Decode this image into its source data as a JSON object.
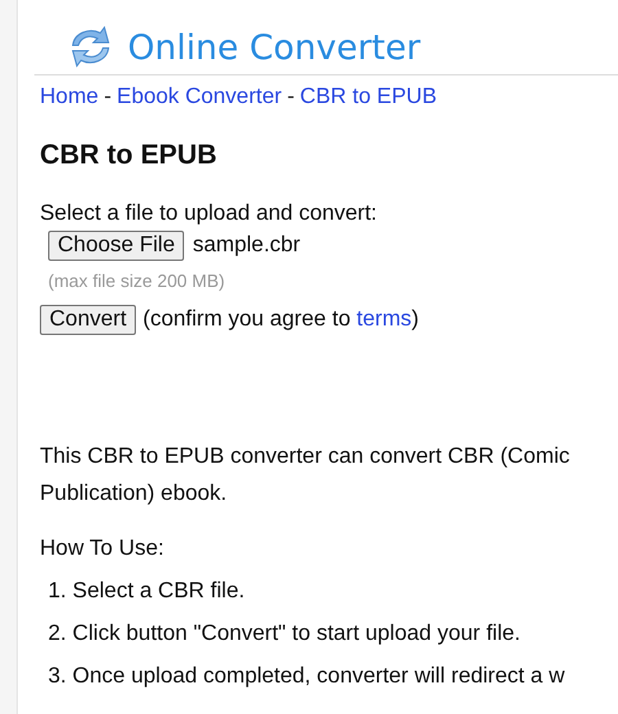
{
  "site": {
    "title": "Online Converter"
  },
  "breadcrumb": [
    {
      "label": "Home"
    },
    {
      "label": "Ebook Converter"
    },
    {
      "label": "CBR to EPUB"
    }
  ],
  "breadcrumb_separator": "-",
  "heading": "CBR to EPUB",
  "upload": {
    "prompt": "Select a file to upload and convert:",
    "choose_button": "Choose File",
    "file_name": "sample.cbr",
    "note": "(max file size 200 MB)",
    "convert_button": "Convert",
    "agree_before": "(confirm you agree to ",
    "agree_link": "terms",
    "agree_after": ")"
  },
  "description": "This CBR to EPUB converter can convert CBR (Comic",
  "description_line2": "Publication) ebook.",
  "how_to": {
    "title": "How To Use:",
    "steps": [
      "1. Select a CBR file.",
      "2. Click button \"Convert\" to start upload your file.",
      "3. Once upload completed, converter will redirect a w"
    ]
  }
}
